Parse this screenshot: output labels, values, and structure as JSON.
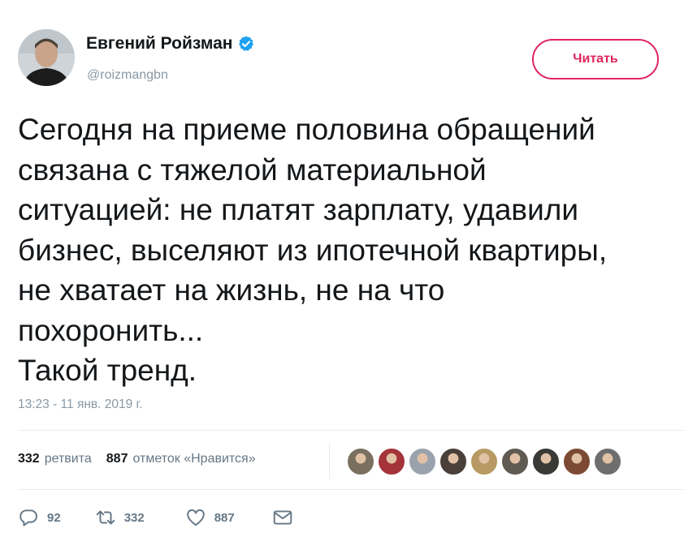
{
  "user": {
    "display_name": "Евгений Ройзман",
    "handle": "@roizmangbn",
    "verified": true
  },
  "follow_button": {
    "label": "Читать",
    "color": "#e0245e"
  },
  "tweet": {
    "text": "Сегодня на приеме половина обращений\nсвязана с тяжелой материальной\nситуацией: не платят зарплату, удавили\nбизнес, выселяют из ипотечной квартиры,\nне хватает на жизнь, не на что\nпохоронить...\nТакой тренд.",
    "timestamp": "13:23 - 11 янв. 2019 г."
  },
  "stats": {
    "retweets_count": "332",
    "retweets_label": "ретвита",
    "likes_count": "887",
    "likes_label": "отметок «Нравится»"
  },
  "likers": [
    {
      "icon": "user-avatar",
      "color": "#7a7060"
    },
    {
      "icon": "user-avatar",
      "color": "#a5333a"
    },
    {
      "icon": "user-avatar",
      "color": "#9aa3ad"
    },
    {
      "icon": "user-avatar",
      "color": "#4a4039"
    },
    {
      "icon": "user-avatar",
      "color": "#b79a63"
    },
    {
      "icon": "user-avatar",
      "color": "#5f5a52"
    },
    {
      "icon": "user-avatar",
      "color": "#3a3a36"
    },
    {
      "icon": "user-avatar",
      "color": "#7c4a33"
    },
    {
      "icon": "user-avatar",
      "color": "#6e6e6e"
    }
  ],
  "actions": {
    "reply_count": "92",
    "retweet_count": "332",
    "like_count": "887"
  },
  "colors": {
    "text": "#14171a",
    "secondary": "#8899a6",
    "verified_blue": "#1da1f2",
    "accent": "#e0245e"
  }
}
